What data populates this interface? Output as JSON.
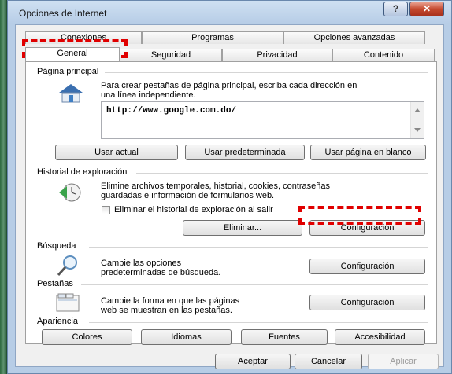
{
  "window": {
    "title": "Opciones de Internet",
    "help_label": "?",
    "close_label": "✕"
  },
  "tabs": {
    "row_back": [
      "Conexiones",
      "Programas",
      "Opciones avanzadas"
    ],
    "row_front": [
      "General",
      "Seguridad",
      "Privacidad",
      "Contenido"
    ],
    "active": "General"
  },
  "home": {
    "section_title": "Página principal",
    "desc_line1": "Para crear pestañas de página principal, escriba cada dirección en",
    "desc_line2": "una línea independiente.",
    "url": "http://www.google.com.do/",
    "btn_current": "Usar actual",
    "btn_default": "Usar predeterminada",
    "btn_blank": "Usar página en blanco"
  },
  "history": {
    "section_title": "Historial de exploración",
    "desc_line1": "Elimine archivos temporales, historial, cookies, contraseñas",
    "desc_line2": "guardadas e información de formularios web.",
    "checkbox_label": "Eliminar el historial de exploración al salir",
    "checkbox_checked": false,
    "btn_delete": "Eliminar...",
    "btn_settings": "Configuración"
  },
  "search": {
    "section_title": "Búsqueda",
    "desc_line1": "Cambie las opciones",
    "desc_line2": "predeterminadas de búsqueda.",
    "btn_settings": "Configuración"
  },
  "tabs_section": {
    "section_title": "Pestañas",
    "desc_line1": "Cambie la forma en que las páginas",
    "desc_line2": "web se muestran en las pestañas.",
    "btn_settings": "Configuración"
  },
  "appearance": {
    "section_title": "Apariencia",
    "btn_colors": "Colores",
    "btn_languages": "Idiomas",
    "btn_fonts": "Fuentes",
    "btn_accessibility": "Accesibilidad"
  },
  "footer": {
    "ok": "Aceptar",
    "cancel": "Cancelar",
    "apply": "Aplicar"
  },
  "colors": {
    "highlight": "#e00000",
    "title_bar": "#b6cce6",
    "close_button": "#c54a2f"
  }
}
